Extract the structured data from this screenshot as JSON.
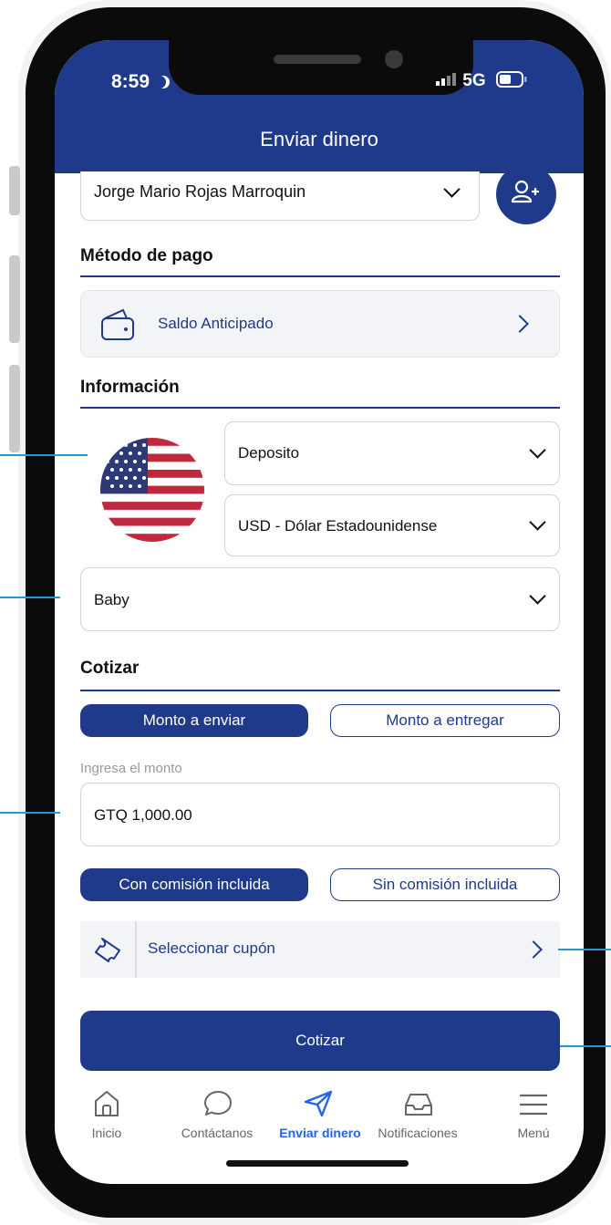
{
  "status_bar": {
    "time": "8:59",
    "network": "5G"
  },
  "header": {
    "title": "Enviar dinero"
  },
  "recipient": {
    "name": "Jorge  Mario  Rojas  Marroquin",
    "add_contact_icon": "person-add-icon"
  },
  "payment": {
    "section_title": "Método de pago",
    "method_label": "Saldo Anticipado",
    "method_icon": "wallet-icon"
  },
  "info": {
    "section_title": "Información",
    "country_flag": "us-flag-icon",
    "delivery_type": "Deposito",
    "currency": "USD - Dólar Estadounidense",
    "relationship": "Baby"
  },
  "quote": {
    "section_title": "Cotizar",
    "tab_send": "Monto a enviar",
    "tab_deliver": "Monto a entregar",
    "amount_label": "Ingresa el monto",
    "amount_value": "GTQ 1,000.00",
    "commission_included": "Con comisión incluida",
    "commission_excluded": "Sin comisión incluida",
    "coupon_label": "Seleccionar cupón",
    "coupon_icon": "ticket-icon",
    "submit_label": "Cotizar"
  },
  "bottom_nav": {
    "items": [
      {
        "label": "Inicio",
        "icon": "home-icon"
      },
      {
        "label": "Contáctanos",
        "icon": "chat-icon"
      },
      {
        "label": "Enviar dinero",
        "icon": "send-icon"
      },
      {
        "label": "Notificaciones",
        "icon": "inbox-icon"
      },
      {
        "label": "Menú",
        "icon": "menu-icon"
      }
    ]
  },
  "colors": {
    "primary": "#1f3a8a",
    "active_nav": "#2563eb",
    "callout": "#2596d6",
    "card_bg": "#f3f4f8"
  }
}
